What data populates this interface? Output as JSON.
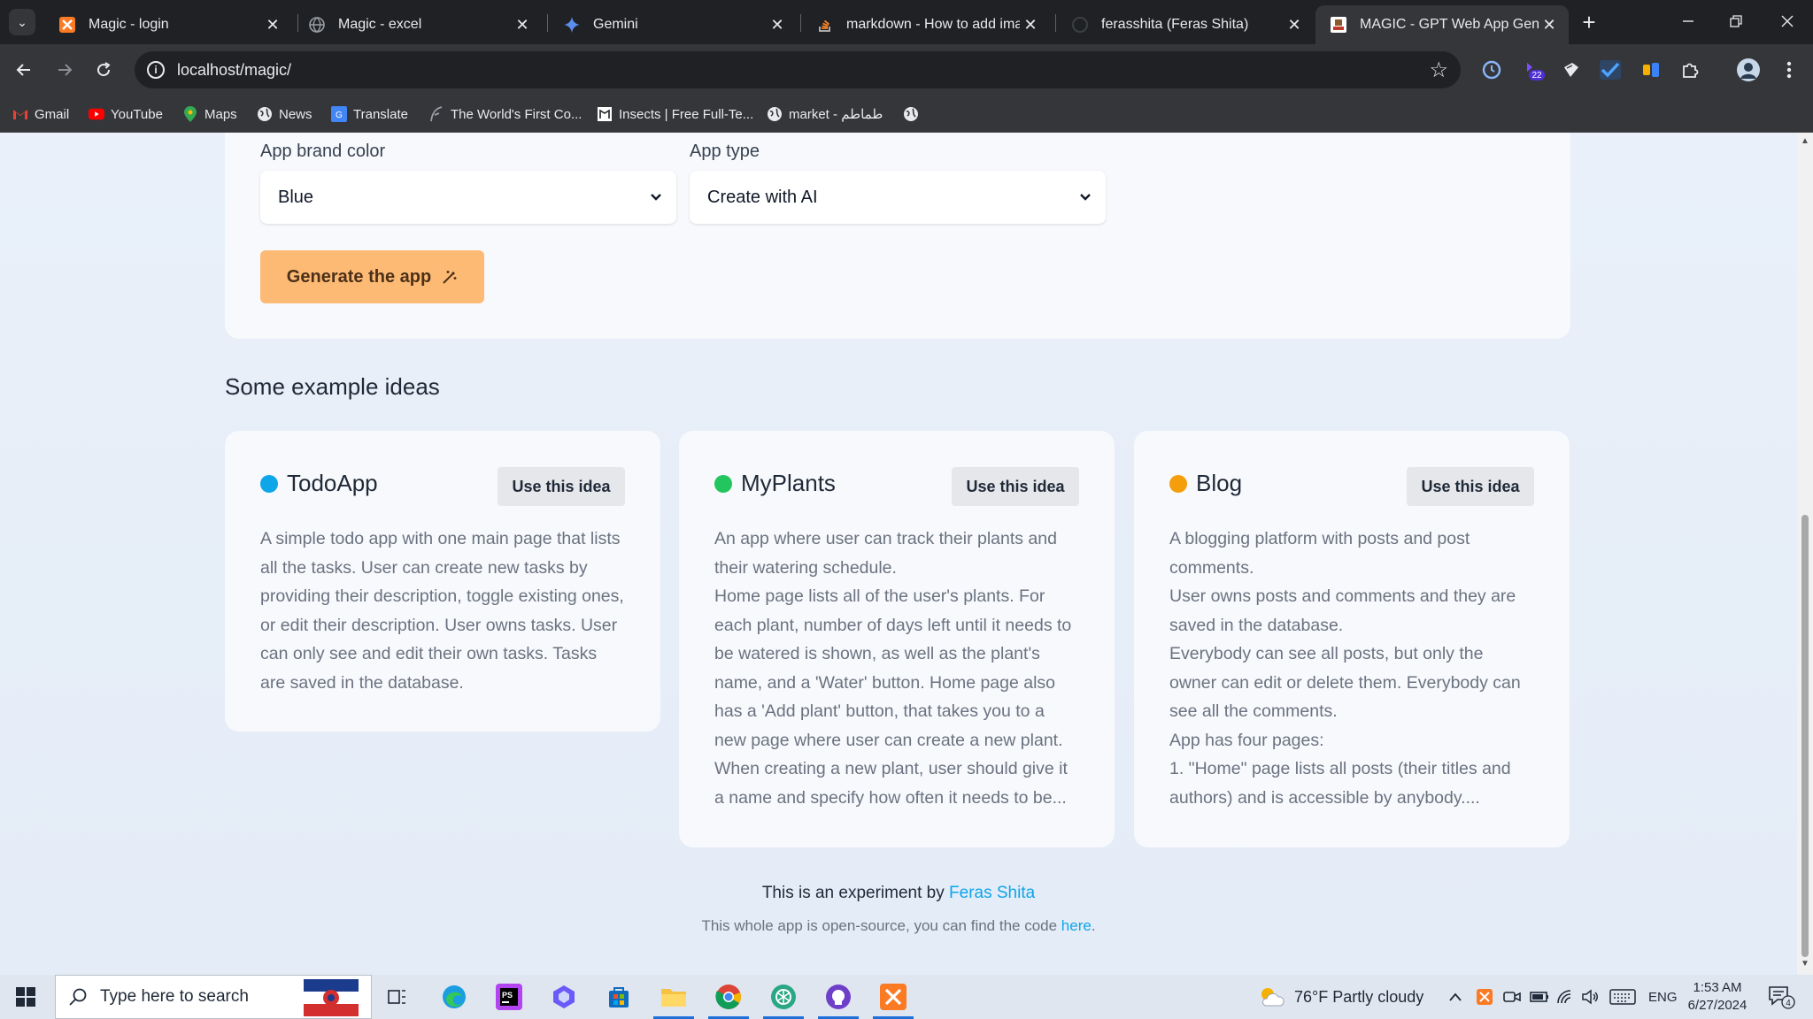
{
  "browser": {
    "tabs": [
      {
        "title": "Magic - login",
        "favicon": "xampp-icon",
        "active": false
      },
      {
        "title": "Magic - excel",
        "favicon": "globe-icon",
        "active": false
      },
      {
        "title": "Gemini",
        "favicon": "gemini-icon",
        "active": false
      },
      {
        "title": "markdown - How to add imag",
        "favicon": "stackoverflow-icon",
        "active": false
      },
      {
        "title": "ferasshita (Feras Shita)",
        "favicon": "github-icon",
        "active": false
      },
      {
        "title": "MAGIC - GPT Web App Gener",
        "favicon": "magic-icon",
        "active": true
      }
    ],
    "url": "localhost/magic/",
    "extension_badge": "22",
    "bookmarks": [
      {
        "label": "Gmail",
        "icon": "gmail-icon"
      },
      {
        "label": "YouTube",
        "icon": "youtube-icon"
      },
      {
        "label": "Maps",
        "icon": "maps-icon"
      },
      {
        "label": "News",
        "icon": "globe-icon"
      },
      {
        "label": "Translate",
        "icon": "translate-icon"
      },
      {
        "label": "The World's First Co...",
        "icon": "feather-icon"
      },
      {
        "label": "Insects | Free Full-Te...",
        "icon": "book-icon"
      },
      {
        "label": "market - طماطم",
        "icon": "globe-icon"
      },
      {
        "label": "",
        "icon": "globe-icon"
      }
    ]
  },
  "form": {
    "brand_color_label": "App brand color",
    "brand_color_value": "Blue",
    "app_type_label": "App type",
    "app_type_value": "Create with AI",
    "generate_label": "Generate the app"
  },
  "ideas": {
    "section_title": "Some example ideas",
    "use_label": "Use this idea",
    "items": [
      {
        "name": "TodoApp",
        "dot_color": "#0ea5e9",
        "description": "A simple todo app with one main page that lists all the tasks. User can create new tasks by providing their description, toggle existing ones, or edit their description. User owns tasks. User can only see and edit their own tasks. Tasks are saved in the database."
      },
      {
        "name": "MyPlants",
        "dot_color": "#22c55e",
        "description": "An app where user can track their plants and their watering schedule.\nHome page lists all of the user's plants. For each plant, number of days left until it needs to be watered is shown, as well as the plant's name, and a 'Water' button. Home page also has a 'Add plant' button, that takes you to a new page where user can create a new plant. When creating a new plant, user should give it a name and specify how often it needs to be..."
      },
      {
        "name": "Blog",
        "dot_color": "#f59e0b",
        "description": "A blogging platform with posts and post comments.\nUser owns posts and comments and they are saved in the database.\nEverybody can see all posts, but only the owner can edit or delete them. Everybody can see all the comments.\nApp has four pages:\n1. \"Home\" page lists all posts (their titles and authors) and is accessible by anybody...."
      }
    ]
  },
  "footer": {
    "line1_prefix": "This is an experiment by ",
    "author": "Feras Shita",
    "line2_prefix": "This whole app is open-source, you can find the code ",
    "code_link": "here",
    "line2_suffix": "."
  },
  "taskbar": {
    "search_placeholder": "Type here to search",
    "weather": "76°F  Partly cloudy",
    "language": "ENG",
    "time": "1:53 AM",
    "date": "6/27/2024",
    "notification_count": "4"
  }
}
